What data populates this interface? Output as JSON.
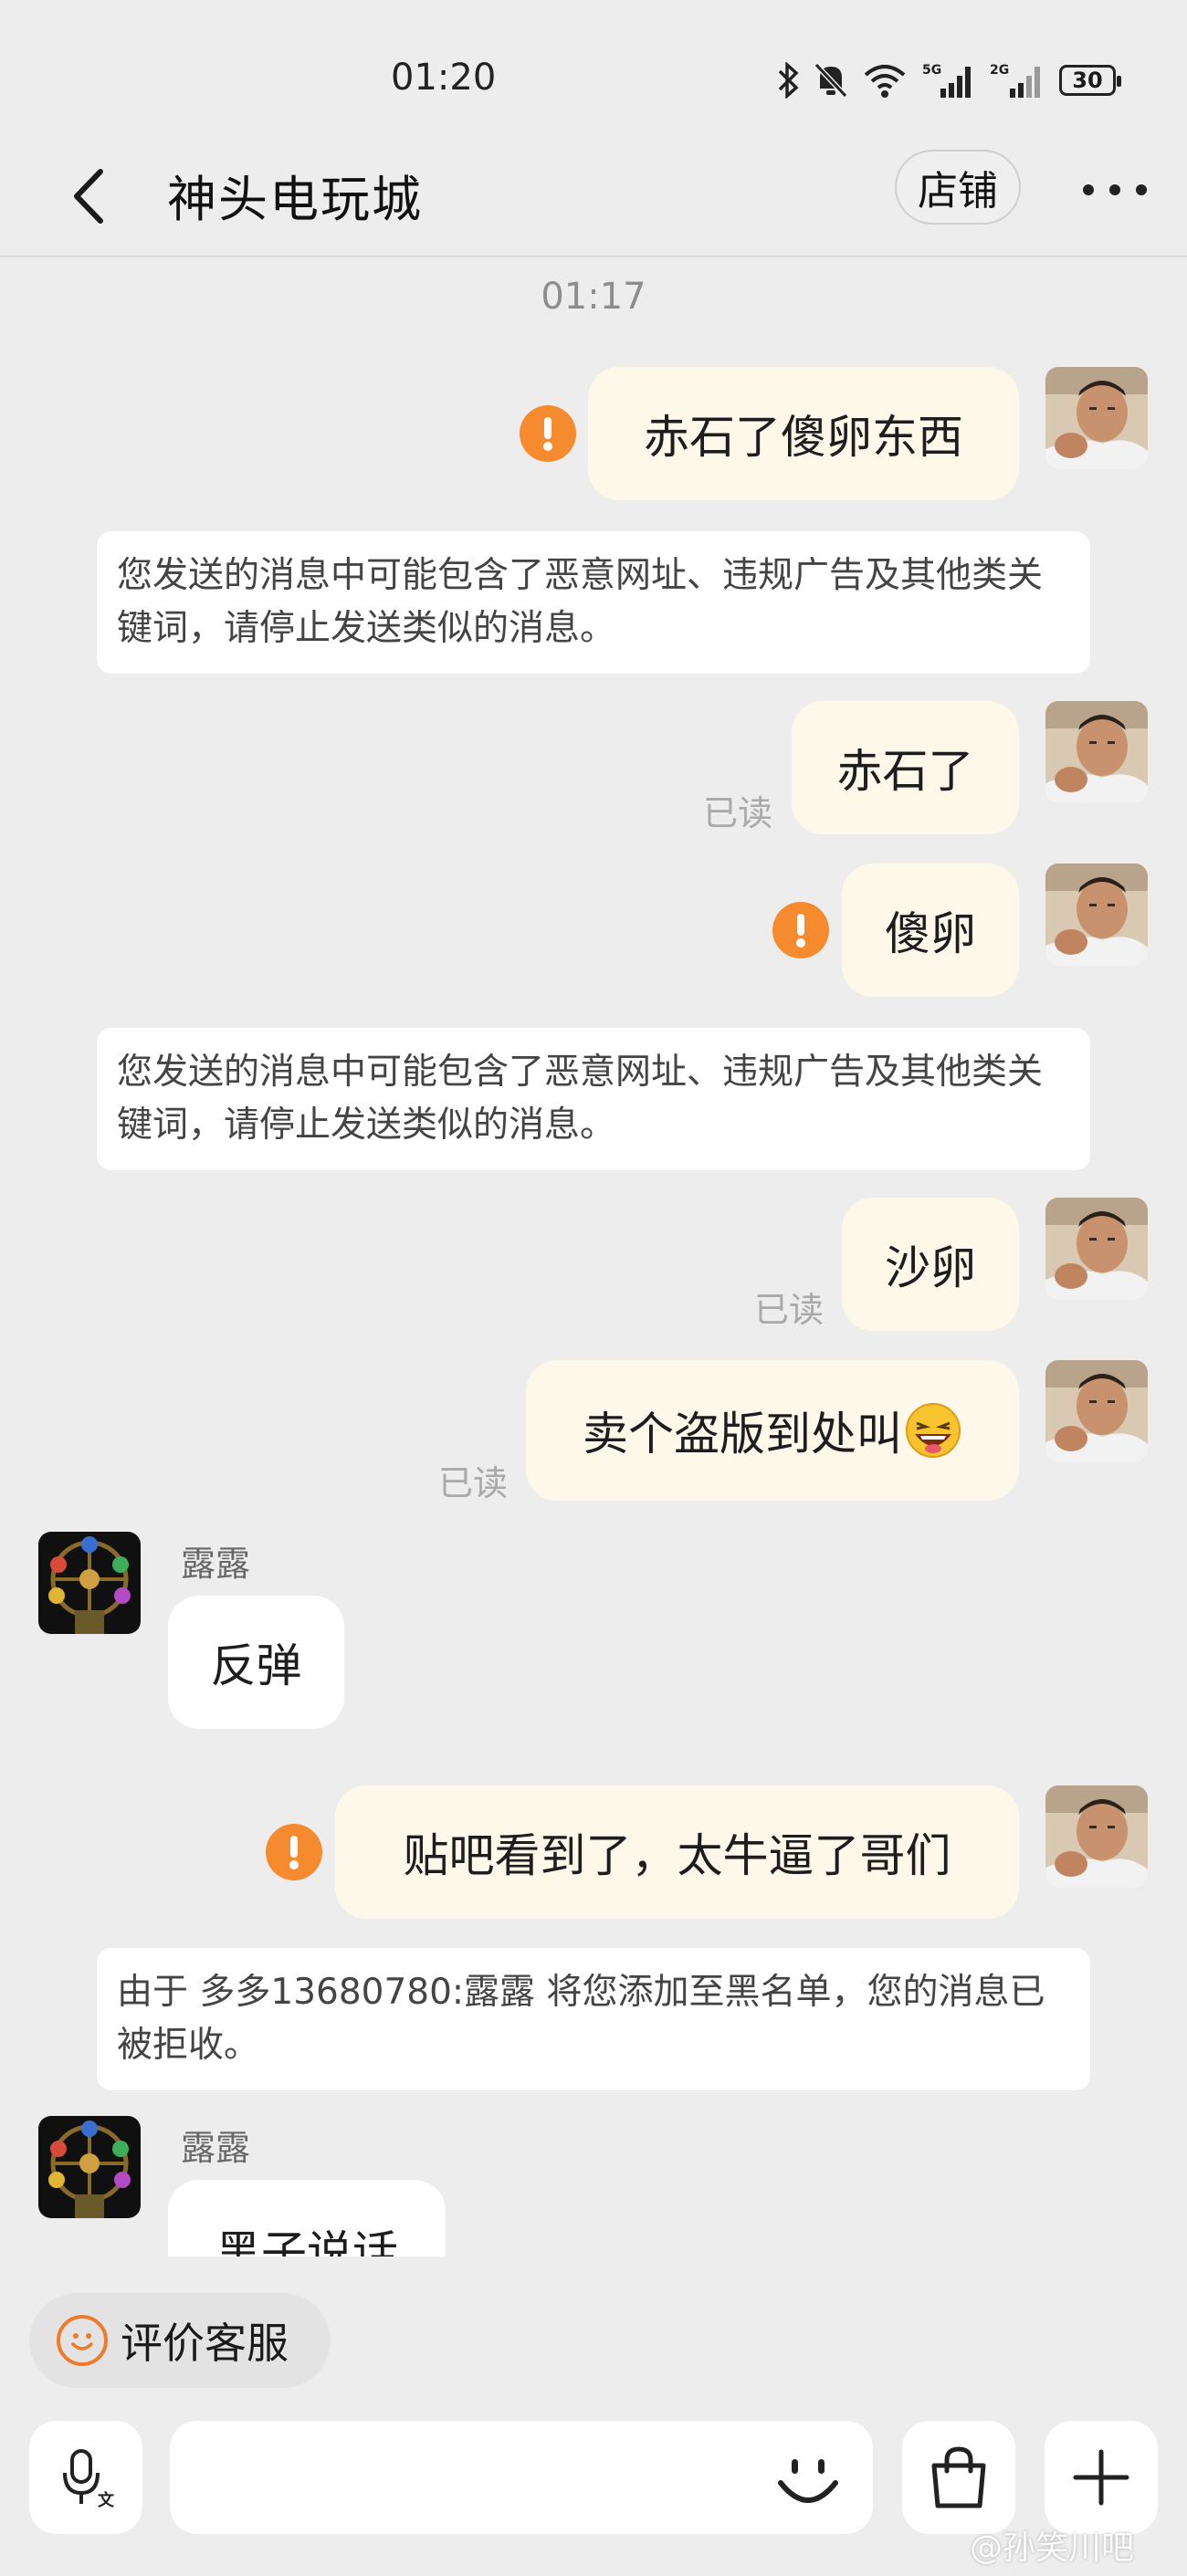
{
  "status_bar": {
    "time": "01:20",
    "battery": "30"
  },
  "header": {
    "title": "神头电玩城",
    "shop_label": "店铺"
  },
  "chat": {
    "time_divider": "01:17",
    "read_label": "已读",
    "messages": [
      {
        "text": "赤石了傻卵东西"
      },
      {
        "text": "赤石了"
      },
      {
        "text": "傻卵"
      },
      {
        "text": "沙卵"
      },
      {
        "text": "卖个盗版到处叫"
      },
      {
        "text": "反弹"
      },
      {
        "text": "贴吧看到了，太牛逼了哥们"
      },
      {
        "text": "黑子说话"
      }
    ],
    "notices": [
      "您发送的消息中可能包含了恶意网址、违规广告及其他类关键词，请停止发送类似的消息。",
      "您发送的消息中可能包含了恶意网址、违规广告及其他类关键词，请停止发送类似的消息。",
      "由于 多多13680780:露露 将您添加至黑名单，您的消息已被拒收。"
    ],
    "other_name": "露露"
  },
  "bottom": {
    "rate_label": "评价客服",
    "input_placeholder": ""
  },
  "watermark": "@孙笑川吧",
  "colors": {
    "bubble_me": "#fdf8ea",
    "warning": "#f58a2e",
    "background": "#ededed"
  }
}
